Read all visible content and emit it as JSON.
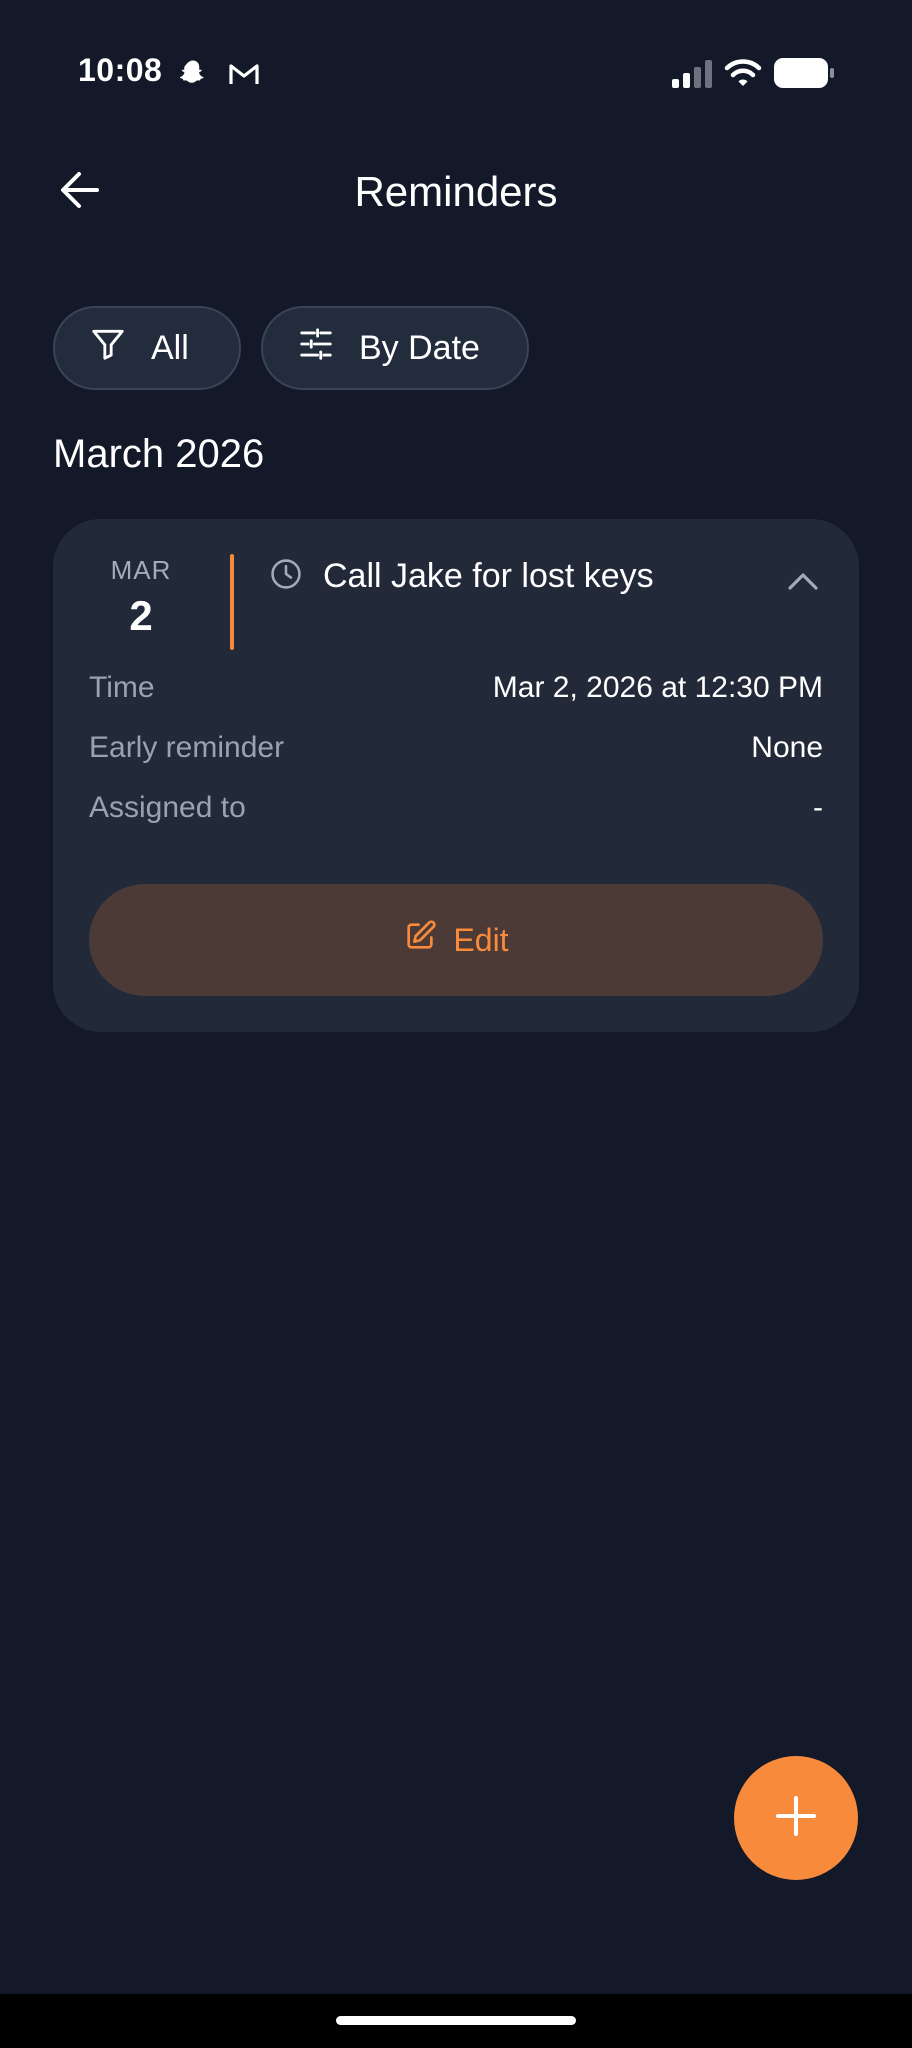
{
  "status_bar": {
    "time": "10:08",
    "icons": [
      "snapchat-icon",
      "gmail-icon",
      "signal-icon",
      "wifi-icon",
      "battery-icon"
    ]
  },
  "header": {
    "title": "Reminders",
    "back_icon": "arrow-left-icon"
  },
  "filters": {
    "all_label": "All",
    "all_icon": "filter-icon",
    "date_label": "By Date",
    "date_icon": "sliders-icon"
  },
  "section": {
    "heading": "March 2026"
  },
  "reminder": {
    "month": "MAR",
    "day": "2",
    "title": "Call Jake for lost keys",
    "details": [
      {
        "label": "Time",
        "value": "Mar 2, 2026 at 12:30 PM"
      },
      {
        "label": "Early reminder",
        "value": "None"
      },
      {
        "label": "Assigned to",
        "value": "-"
      }
    ],
    "edit_label": "Edit"
  },
  "colors": {
    "background": "#131928",
    "card": "#222a3a",
    "accent": "#f78a3b",
    "edit_button_bg": "#4c3a37"
  },
  "fab_icon": "plus-icon"
}
